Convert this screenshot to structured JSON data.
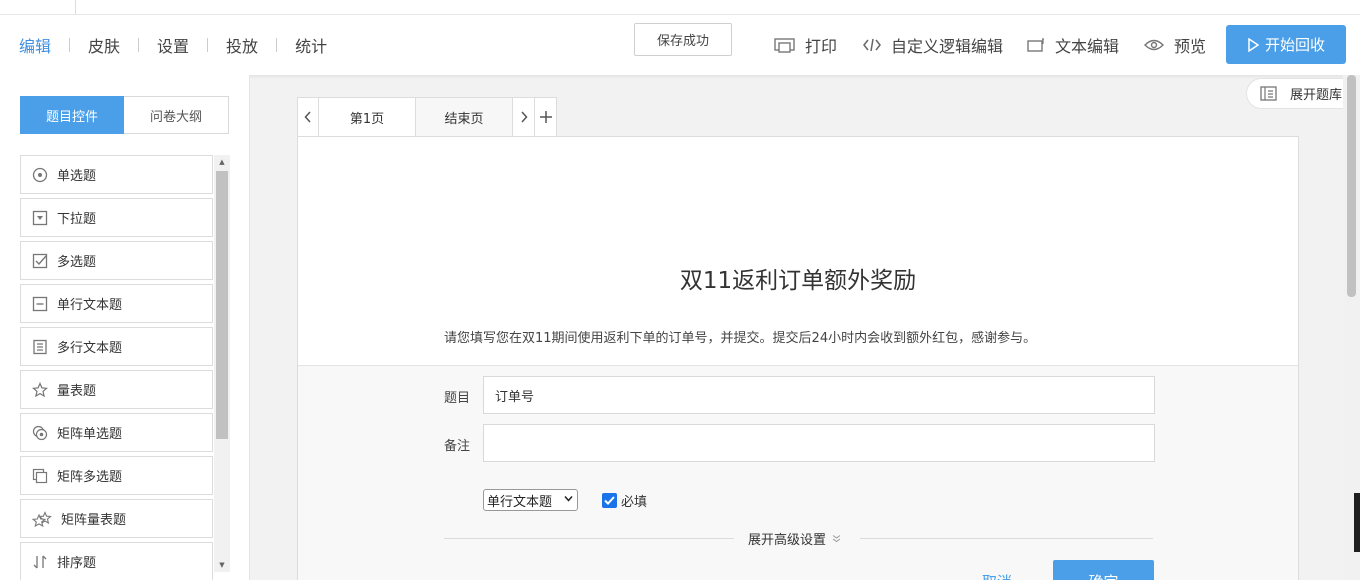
{
  "nav": {
    "items": [
      "编辑",
      "皮肤",
      "设置",
      "投放",
      "统计"
    ]
  },
  "header": {
    "save_status": "保存成功",
    "print": "打印",
    "custom_logic": "自定义逻辑编辑",
    "text_edit": "文本编辑",
    "preview": "预览",
    "start_collect": "开始回收",
    "expand_library": "展开题库"
  },
  "left_panel": {
    "tabs": [
      "题目控件",
      "问卷大纲"
    ],
    "controls": [
      {
        "label": "单选题",
        "icon": "radio-icon"
      },
      {
        "label": "下拉题",
        "icon": "dropdown-icon"
      },
      {
        "label": "多选题",
        "icon": "checkbox-icon"
      },
      {
        "label": "单行文本题",
        "icon": "single-line-text-icon"
      },
      {
        "label": "多行文本题",
        "icon": "multi-line-text-icon"
      },
      {
        "label": "量表题",
        "icon": "star-icon"
      },
      {
        "label": "矩阵单选题",
        "icon": "matrix-radio-icon"
      },
      {
        "label": "矩阵多选题",
        "icon": "matrix-checkbox-icon"
      },
      {
        "label": "矩阵量表题",
        "icon": "matrix-star-icon"
      },
      {
        "label": "排序题",
        "icon": "sort-icon"
      }
    ]
  },
  "pages": {
    "tabs": [
      "第1页",
      "结束页"
    ]
  },
  "survey": {
    "title": "双11返利订单额外奖励",
    "description": "请您填写您在双11期间使用返利下单的订单号，并提交。提交后24小时内会收到额外红包，感谢参与。"
  },
  "editor": {
    "question_label": "题目",
    "question_value": "订单号",
    "note_label": "备注",
    "note_value": "",
    "question_type": "单行文本题",
    "required_label": "必填",
    "required_checked": true,
    "advanced_settings": "展开高级设置",
    "cancel": "取消",
    "confirm": "确定"
  },
  "colors": {
    "accent": "#4a9fe8"
  }
}
